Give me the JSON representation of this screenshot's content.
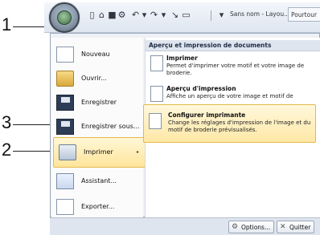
{
  "callouts": [
    "1",
    "2",
    "3"
  ],
  "toolbar": {
    "title": "Sans nom - Layou...",
    "tab_label": "Pourtour",
    "icons": [
      "new-icon",
      "open-icon",
      "save-icon",
      "undo-icon",
      "redo-icon",
      "dropdown-icon"
    ]
  },
  "menu": {
    "items": [
      {
        "label": "Nouveau",
        "icon": "new-document-icon"
      },
      {
        "label": "Ouvrir...",
        "icon": "open-folder-icon"
      },
      {
        "label": "Enregistrer",
        "icon": "save-icon"
      },
      {
        "label": "Enregistrer sous...",
        "icon": "save-as-icon"
      },
      {
        "label": "Imprimer",
        "icon": "print-icon",
        "submenu_arrow": "▸"
      },
      {
        "label": "Assistant...",
        "icon": "wizard-icon"
      },
      {
        "label": "Exporter...",
        "icon": "export-icon"
      }
    ]
  },
  "submenu": {
    "header": "Aperçu et impression de documents",
    "items": [
      {
        "title": "Imprimer",
        "desc": "Permet d'imprimer votre motif et votre image de broderie."
      },
      {
        "title": "Aperçu d'impression",
        "desc": "Affiche un aperçu de votre image et motif de"
      },
      {
        "title": "Configurer imprimante",
        "desc": "Change les réglages d'impression de l'image et du motif de broderie prévisualisés."
      }
    ]
  },
  "bottom": {
    "options_label": "Options...",
    "quit_label": "Quitter"
  },
  "colors": {
    "highlight_border": "#e4b94a",
    "highlight_fill": "#ffe59b",
    "panel_bg": "#eef1f6"
  }
}
